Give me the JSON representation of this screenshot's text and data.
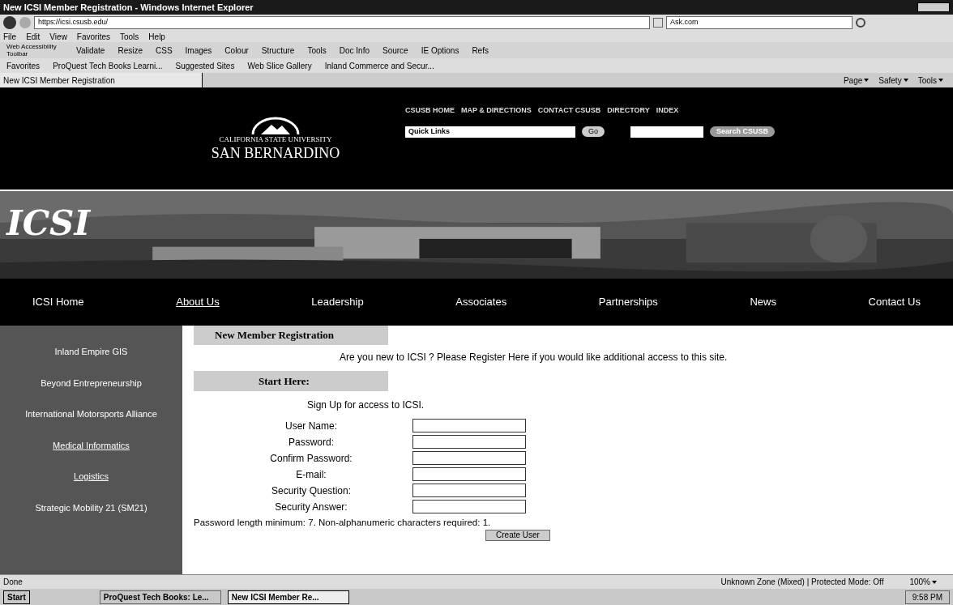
{
  "window": {
    "title": "New ICSI Member Registration - Windows Internet Explorer"
  },
  "browser": {
    "address": "https://icsi.csusb.edu/",
    "search_value": "Ask.com",
    "menu": [
      "File",
      "Edit",
      "View",
      "Favorites",
      "Tools",
      "Help"
    ],
    "toolbar": [
      "Web Accessibility Toolbar",
      "Validate",
      "Resize",
      "CSS",
      "Images",
      "Colour",
      "Structure",
      "Tools",
      "Doc Info",
      "Source",
      "IE Options",
      "Refs"
    ],
    "favorites_label": "Favorites",
    "favorites": [
      "ProQuest Tech Books Learni...",
      "Suggested Sites",
      "Web Slice Gallery",
      "Inland Commerce and Secur..."
    ],
    "tab": "New ICSI Member Registration",
    "commands": [
      "Page",
      "Safety",
      "Tools"
    ]
  },
  "site": {
    "top_links": [
      "CSUSB HOME",
      "MAP & DIRECTIONS",
      "CONTACT CSUSB",
      "DIRECTORY",
      "INDEX"
    ],
    "quick_links": "Quick Links",
    "go": "Go",
    "search_button": "Search CSUSB",
    "logo_top": "CALIFORNIA STATE UNIVERSITY",
    "logo_bottom": "SAN BERNARDINO",
    "banner_title": "ICSI",
    "nav": [
      {
        "label": "ICSI Home",
        "underlined": false
      },
      {
        "label": "About Us",
        "underlined": true
      },
      {
        "label": "Leadership",
        "underlined": false
      },
      {
        "label": "Associates",
        "underlined": false
      },
      {
        "label": "Partnerships",
        "underlined": false
      },
      {
        "label": "News",
        "underlined": false
      },
      {
        "label": "Contact Us",
        "underlined": false
      }
    ],
    "sidebar": [
      {
        "label": "Inland Empire GIS",
        "underlined": false
      },
      {
        "label": "Beyond Entrepreneurship",
        "underlined": false
      },
      {
        "label": "International Motorsports Alliance",
        "underlined": false
      },
      {
        "label": "Medical Informatics",
        "underlined": true
      },
      {
        "label": "Logistics",
        "underlined": true
      },
      {
        "label": "Strategic Mobility 21 (SM21)",
        "underlined": false
      }
    ],
    "form": {
      "heading": "New Member Registration",
      "intro": "Are you new to ICSI ? Please Register Here if you would like additional access to this site.",
      "start": "Start Here:",
      "signup": "Sign Up for access to ICSI.",
      "fields": [
        "User Name:",
        "Password:",
        "Confirm Password:",
        "E-mail:",
        "Security Question:",
        "Security Answer:"
      ],
      "note": "Password length minimum: 7. Non-alphanumeric characters required: 1.",
      "button": "Create User"
    }
  },
  "status_bar": {
    "text": "Done",
    "zone": "Unknown Zone (Mixed) | Protected Mode: Off",
    "zoom": "100%"
  },
  "taskbar": {
    "start": "Start",
    "tasks": [
      {
        "label": "ProQuest Tech Books: Le...",
        "selected": false
      },
      {
        "label": "New ICSI Member Re...",
        "selected": true
      }
    ],
    "clock": "9:58 PM"
  }
}
